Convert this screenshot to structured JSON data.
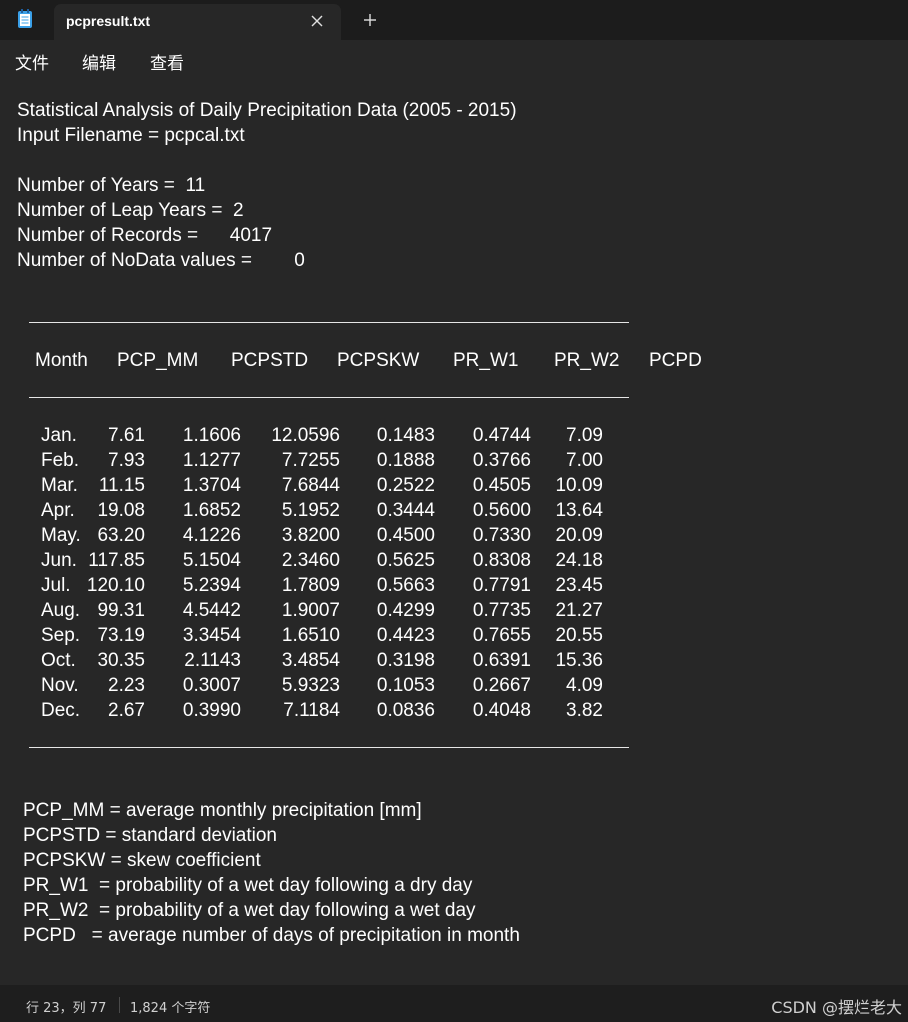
{
  "tab": {
    "title": "pcpresult.txt",
    "close_icon": "close-icon",
    "new_tab_icon": "plus-icon"
  },
  "menu": [
    "文件",
    "编辑",
    "查看"
  ],
  "document": {
    "header_lines": [
      "Statistical Analysis of Daily Precipitation Data (2005 - 2015)",
      "Input Filename = pcpcal.txt",
      "",
      "Number of Years =  11",
      "Number of Leap Years =  2",
      "Number of Records =      4017",
      "Number of NoData values =        0"
    ],
    "table": {
      "headers": [
        "Month",
        "PCP_MM",
        "PCPSTD",
        "PCPSKW",
        "PR_W1",
        "PR_W2",
        "PCPD"
      ],
      "rows": [
        [
          "Jan.",
          "7.61",
          "1.1606",
          "12.0596",
          "0.1483",
          "0.4744",
          "7.09"
        ],
        [
          "Feb.",
          "7.93",
          "1.1277",
          "7.7255",
          "0.1888",
          "0.3766",
          "7.00"
        ],
        [
          "Mar.",
          "11.15",
          "1.3704",
          "7.6844",
          "0.2522",
          "0.4505",
          "10.09"
        ],
        [
          "Apr.",
          "19.08",
          "1.6852",
          "5.1952",
          "0.3444",
          "0.5600",
          "13.64"
        ],
        [
          "May.",
          "63.20",
          "4.1226",
          "3.8200",
          "0.4500",
          "0.7330",
          "20.09"
        ],
        [
          "Jun.",
          "117.85",
          "5.1504",
          "2.3460",
          "0.5625",
          "0.8308",
          "24.18"
        ],
        [
          "Jul.",
          "120.10",
          "5.2394",
          "1.7809",
          "0.5663",
          "0.7791",
          "23.45"
        ],
        [
          "Aug.",
          "99.31",
          "4.5442",
          "1.9007",
          "0.4299",
          "0.7735",
          "21.27"
        ],
        [
          "Sep.",
          "73.19",
          "3.3454",
          "1.6510",
          "0.4423",
          "0.7655",
          "20.55"
        ],
        [
          "Oct.",
          "30.35",
          "2.1143",
          "3.4854",
          "0.3198",
          "0.6391",
          "15.36"
        ],
        [
          "Nov.",
          "2.23",
          "0.3007",
          "5.9323",
          "0.1053",
          "0.2667",
          "4.09"
        ],
        [
          "Dec.",
          "2.67",
          "0.3990",
          "7.1184",
          "0.0836",
          "0.4048",
          "3.82"
        ]
      ]
    },
    "legend_lines": [
      "PCP_MM = average monthly precipitation [mm]",
      "PCPSTD = standard deviation",
      "PCPSKW = skew coefficient",
      "PR_W1  = probability of a wet day following a dry day",
      "PR_W2  = probability of a wet day following a wet day",
      "PCPD   = average number of days of precipitation in month"
    ]
  },
  "status": {
    "position": "行 23，列 77",
    "char_count": "1,824 个字符"
  },
  "watermark": "CSDN @摆烂老大"
}
